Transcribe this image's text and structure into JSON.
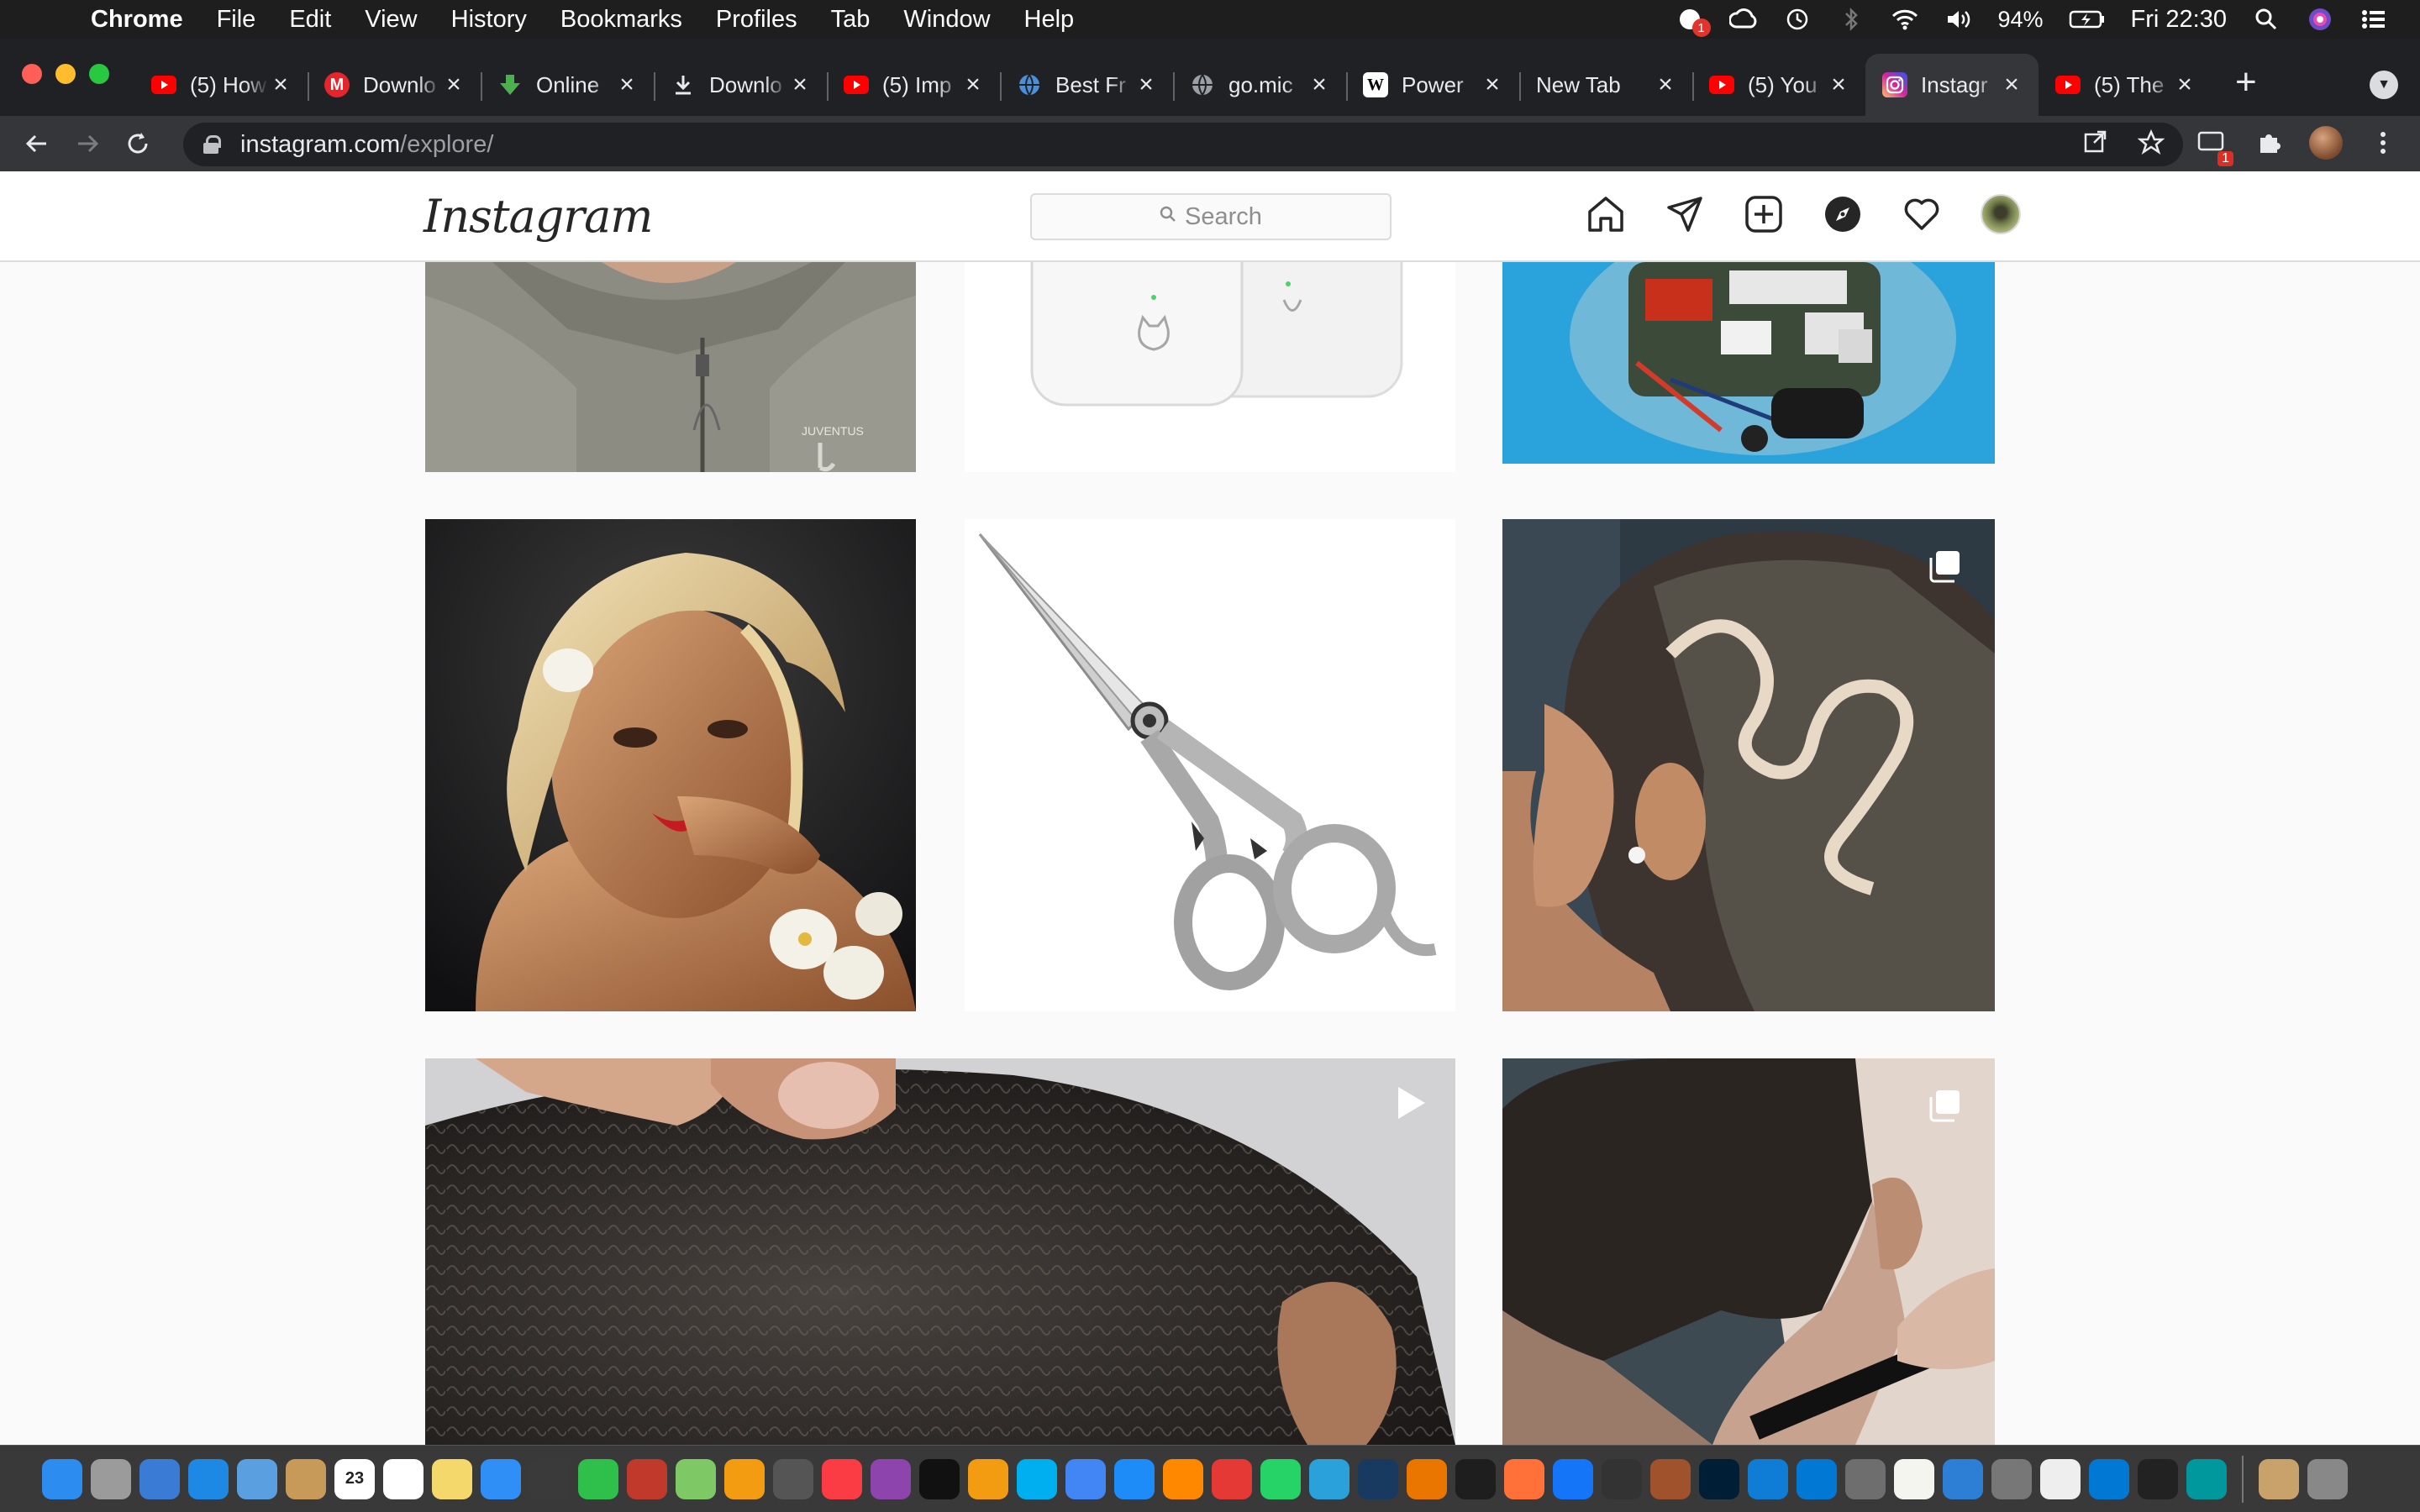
{
  "menubar": {
    "app_name": "Chrome",
    "items": [
      "File",
      "Edit",
      "View",
      "History",
      "Bookmarks",
      "Profiles",
      "Tab",
      "Window",
      "Help"
    ],
    "battery": "94%",
    "clock": "Fri 22:30",
    "notification_badge": "1"
  },
  "tabs": [
    {
      "title": "(5) How",
      "favicon": "youtube-icon",
      "color": "#ff0000"
    },
    {
      "title": "Downlo",
      "favicon": "m-icon",
      "color": "#e5242b"
    },
    {
      "title": "Online",
      "favicon": "download-arrow-icon",
      "color": "#4caf50"
    },
    {
      "title": "Downlo",
      "favicon": "download-icon",
      "color": "#e8eaed"
    },
    {
      "title": "(5) Imp",
      "favicon": "youtube-icon",
      "color": "#ff0000"
    },
    {
      "title": "Best Fr",
      "favicon": "globe-icon",
      "color": "#4a8fd8"
    },
    {
      "title": "go.mic",
      "favicon": "globe-icon",
      "color": "#9aa0a6"
    },
    {
      "title": "Power",
      "favicon": "wikipedia-icon",
      "color": "#ffffff"
    },
    {
      "title": "New Tab",
      "favicon": "",
      "color": ""
    },
    {
      "title": "(5) You",
      "favicon": "youtube-icon",
      "color": "#ff0000"
    },
    {
      "title": "Instagr",
      "favicon": "instagram-icon",
      "color": "#d6249f"
    },
    {
      "title": "(5) The",
      "favicon": "youtube-icon",
      "color": "#ff0000"
    }
  ],
  "active_tab_index": 10,
  "toolbar": {
    "url_host": "instagram.com",
    "url_path": "/explore/",
    "extension_badge": "1"
  },
  "instagram": {
    "logo_text": "Instagram",
    "search_placeholder": "Search",
    "brand_colors": {
      "text": "#262626",
      "border": "#dbdbdb",
      "background": "#fafafa"
    }
  },
  "posts": [
    {
      "subject": "man in grey Juventus zip jacket",
      "jacket_text": "JUVENTUS",
      "overlay": ""
    },
    {
      "subject": "white earbud cases with cat and dog faces",
      "overlay": ""
    },
    {
      "subject": "robot electronics on blue background",
      "overlay": ""
    },
    {
      "subject": "illustrated blonde woman with orchids",
      "overlay": ""
    },
    {
      "subject": "silver barber scissors",
      "overlay": ""
    },
    {
      "subject": "man with haircut design",
      "overlay": "carousel-icon"
    },
    {
      "subject": "close-up of short curly hair",
      "overlay": "play-icon"
    },
    {
      "subject": "beard trim with straight razor",
      "overlay": "carousel-icon"
    }
  ],
  "dock": {
    "calendar_day": "23",
    "apps": [
      "finder",
      "launchpad",
      "mission-control",
      "safari",
      "preview",
      "notes",
      "calendar",
      "reminders",
      "stickies",
      "messages",
      "help",
      "facetime",
      "photo-booth",
      "maps",
      "photos",
      "calculator",
      "music",
      "podcasts",
      "apple-tv",
      "books",
      "skype",
      "chrome",
      "app-store",
      "vlc",
      "no-entry",
      "whatsapp",
      "telegram",
      "virtualbox",
      "blender",
      "terminal",
      "firefox",
      "xcode",
      "compass",
      "scissors-tool",
      "photoshop",
      "edge",
      "vscode",
      "system-preferences",
      "notes2",
      "bluetooth",
      "automator",
      "preview2",
      "vscode2",
      "unity",
      "arduino",
      "archive",
      "trash"
    ]
  }
}
